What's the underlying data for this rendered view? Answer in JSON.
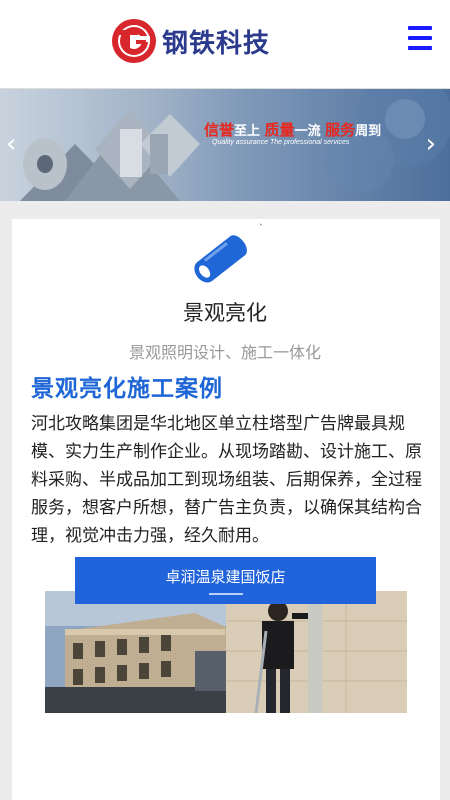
{
  "header": {
    "logo_text": "钢铁科技",
    "logo_icon": "tg-logo-icon",
    "menu_icon": "hamburger-menu-icon"
  },
  "banner": {
    "slogan_part1": "信誉",
    "slogan_part2": "至上 ",
    "slogan_part3": "质量",
    "slogan_part4": "一流 ",
    "slogan_part5": "服务",
    "slogan_part6": "周到",
    "slogan_en": "Quality assurance The professional services"
  },
  "section": {
    "tick": "`",
    "icon": "pipe-icon",
    "title": "景观亮化",
    "subtitle": "景观照明设计、施工一体化",
    "case_title": "景观亮化施工案例",
    "description": "河北攻略集团是华北地区单立柱塔型广告牌最具规模、实力生产制作企业。从现场踏勘、设计施工、原料采购、半成品加工到现场组装、后期保养，全过程服务，想客户所想，替广告主负责，以确保其结构合理，视觉冲击力强，经久耐用。",
    "project_name": "卓润温泉建国饭店"
  },
  "colors": {
    "accent_blue": "#1f66d6",
    "tab_blue": "#2163da",
    "menu_blue": "#1a1aff",
    "slogan_red": "#e8271e",
    "logo_navy": "#2b3a8c"
  }
}
